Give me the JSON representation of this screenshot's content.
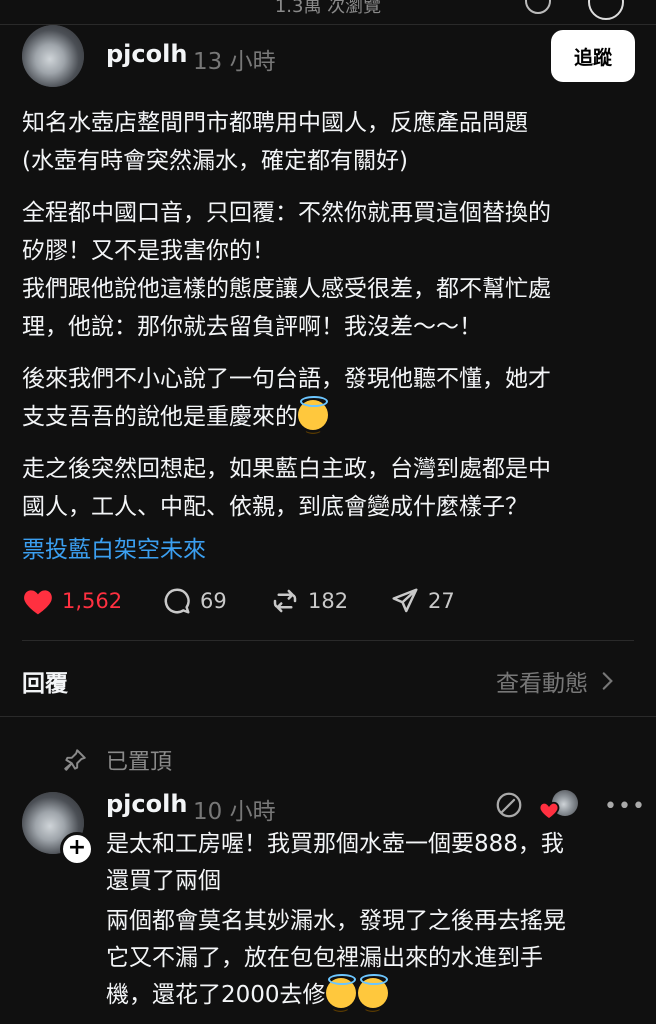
{
  "top": {
    "views": "1.3萬 次瀏覽"
  },
  "post": {
    "username": "pjcolh",
    "time": "13 小時",
    "follow_label": "追蹤",
    "paragraphs": [
      "知名水壺店整間門市都聘用中國人，反應產品問題\n(水壺有時會突然漏水，確定都有關好)",
      "全程都中國口音，只回覆：不然你就再買這個替換的\n矽膠！又不是我害你的！",
      "我們跟他說他這樣的態度讓人感受很差，都不幫忙處\n理，他說：那你就去留負評啊！我沒差～～！",
      "後來我們不小心說了一句台語，發現他聽不懂，她才\n支支吾吾的說他是重慶來的",
      "走之後突然回想起，如果藍白主政，台灣到處都是中\n國人，工人、中配、依親，到底會變成什麼樣子？"
    ],
    "hashtag": "票投藍白架空未來",
    "likes": "1,562",
    "comments": "69",
    "reposts": "182",
    "shares": "27",
    "accent": "#ff3040",
    "link_color": "#3b9ff0"
  },
  "replies_section": {
    "title": "回覆",
    "activity_label": "查看動態"
  },
  "pinned_label": "已置頂",
  "reply": {
    "username": "pjcolh",
    "time": "10 小時",
    "more": "•••",
    "paragraphs": [
      "是太和工房喔！我買那個水壺一個要888，我\n還買了兩個",
      "兩個都會莫名其妙漏水，發現了之後再去搖晃\n它又不漏了，放在包包裡漏出來的水進到手\n機，還花了2000去修"
    ]
  }
}
